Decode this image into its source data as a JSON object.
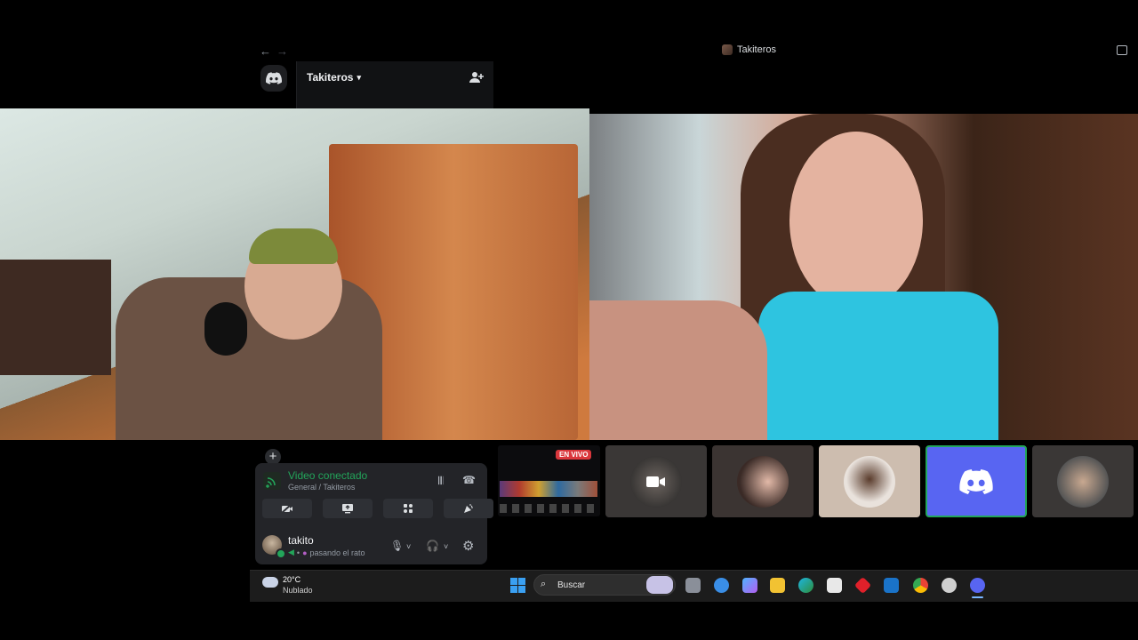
{
  "window": {
    "back_icon": "arrow-left-icon",
    "forward_icon": "arrow-right-icon",
    "server_title": "Takiteros",
    "inbox_icon": "inbox-icon"
  },
  "sidebar": {
    "server_name": "Takiteros",
    "invite_icon": "add-user-icon"
  },
  "voice": {
    "status": "Video conectado",
    "channel": "General / Takiteros",
    "buttons": [
      "camera-off-icon",
      "screen-share-icon",
      "activities-icon",
      "soundboard-icon"
    ]
  },
  "user": {
    "name": "takito",
    "status": "pasando el rato"
  },
  "participants": {
    "live_label": "EN VIVO",
    "tiles": [
      "stream",
      "camera-icon",
      "avatar",
      "avatar",
      "discord-icon",
      "avatar"
    ]
  },
  "taskbar": {
    "temp": "20°C",
    "weather": "Nublado",
    "search_placeholder": "Buscar"
  },
  "colors": {
    "connected_green": "#23a55a",
    "discord_blurple": "#5865f2",
    "live_red": "#da373c"
  }
}
